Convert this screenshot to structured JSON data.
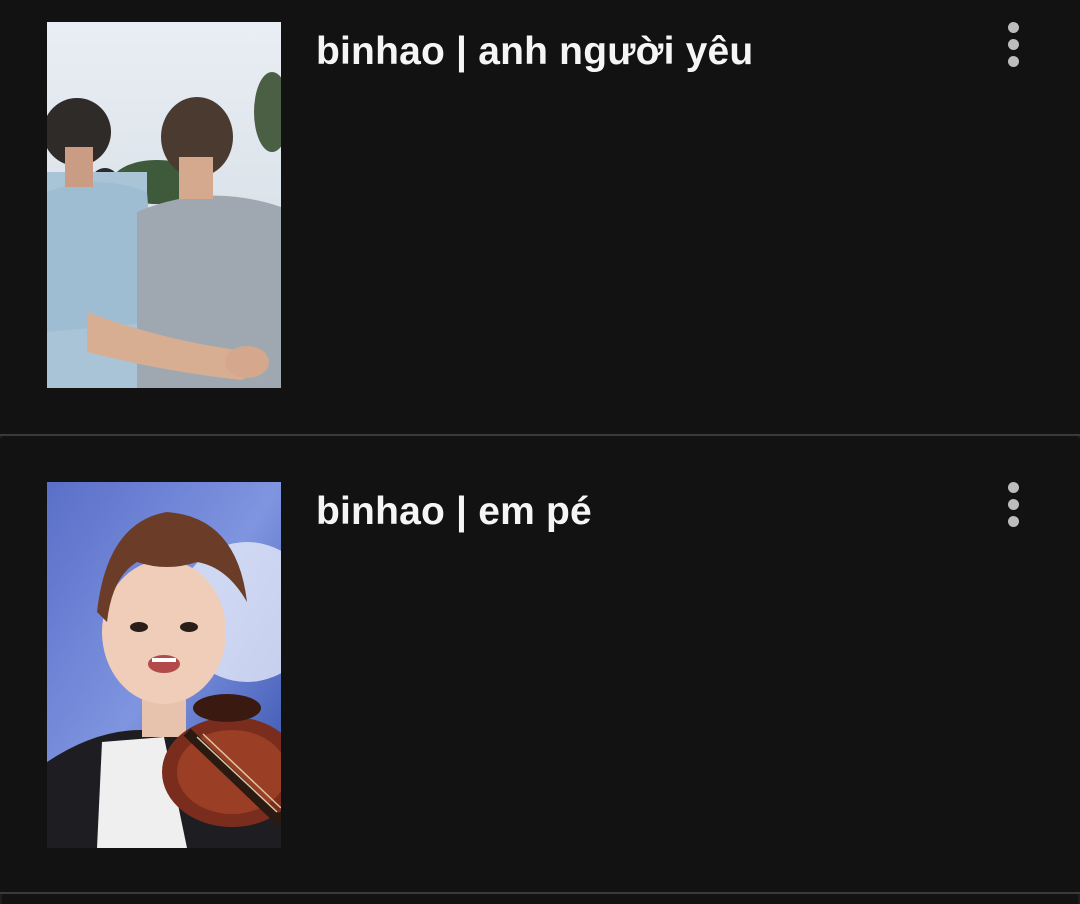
{
  "stories": [
    {
      "title": "binhao | anh người yêu",
      "cover_description_icon": "photo-two-people-back-view"
    },
    {
      "title": "binhao | em pé",
      "cover_description_icon": "photo-boy-with-violin"
    }
  ],
  "colors": {
    "background": "#121212",
    "divider": "#3a3a3a",
    "title_text": "#f5f5f5",
    "menu_dots": "#bdbdbd"
  },
  "icons": {
    "more": "more-vertical-icon"
  }
}
